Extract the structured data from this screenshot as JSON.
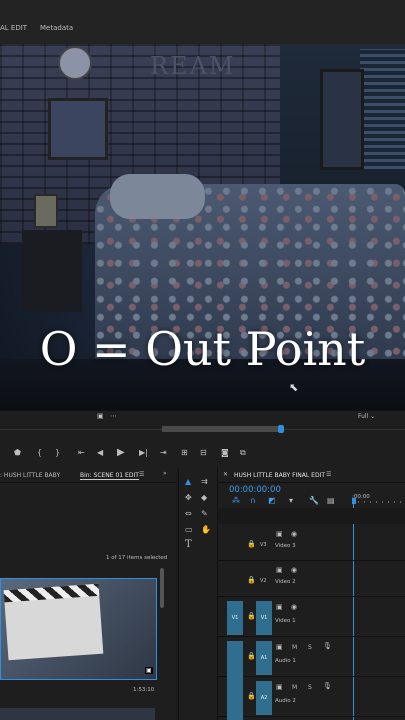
{
  "top_tabs": {
    "final_edit": "AL EDIT",
    "metadata": "Metadata"
  },
  "monitor": {
    "overlay": "O = Out Point",
    "wall_sign": "REAM",
    "fit": "Full"
  },
  "project_panel": {
    "tab_project": ": HUSH LITTLE BABY",
    "tab_bin": "Bin: SCENE 01 EDIT",
    "items_selected": "1 of 17 items selected",
    "clip_duration": "1:53:10",
    "menu_icon": "hamburger-icon"
  },
  "timeline": {
    "tab": "HUSH LITTLE BABY FINAL EDIT",
    "timecode": "00:00:00:00",
    "ruler_label": ":00:00",
    "tracks": [
      {
        "id": "V3",
        "name": "Video 3",
        "src": ""
      },
      {
        "id": "V2",
        "name": "Video 2",
        "src": ""
      },
      {
        "id": "V1",
        "name": "Video 1",
        "src": "V1"
      },
      {
        "id": "A1",
        "name": "Audio 1",
        "src": ""
      },
      {
        "id": "A2",
        "name": "Audio 2",
        "src": ""
      }
    ],
    "mute": "M",
    "solo": "S"
  },
  "colors": {
    "accent": "#2f8fe0",
    "track_blue": "#2f6e8f"
  }
}
